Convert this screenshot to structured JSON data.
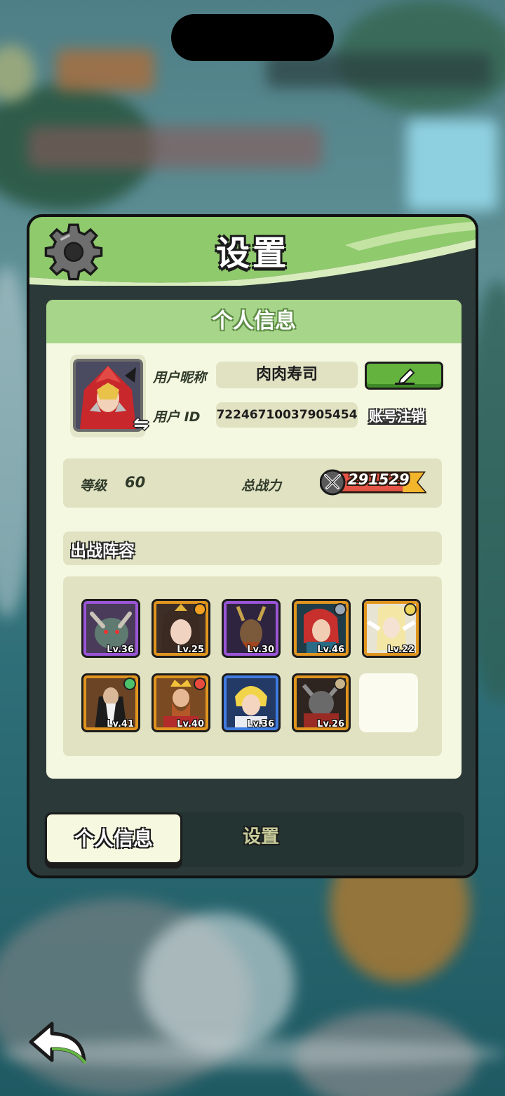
{
  "panel": {
    "title": "设置",
    "section_title": "个人信息"
  },
  "profile": {
    "nickname_label": "用户昵称",
    "nickname": "肉肉寿司",
    "id_label": "用户 ID",
    "user_id": "72246710037905454",
    "logout_label": "账号注销"
  },
  "stats": {
    "level_label": "等级",
    "level": "60",
    "power_label": "总战力",
    "power": "291529"
  },
  "lineup": {
    "title": "出战阵容",
    "heroes": [
      {
        "level": "Lv.36",
        "rarity": "purple"
      },
      {
        "level": "Lv.25",
        "rarity": "orange"
      },
      {
        "level": "Lv.30",
        "rarity": "purple"
      },
      {
        "level": "Lv.46",
        "rarity": "orange"
      },
      {
        "level": "Lv.22",
        "rarity": "orange"
      },
      {
        "level": "Lv.41",
        "rarity": "orange"
      },
      {
        "level": "Lv.40",
        "rarity": "orange"
      },
      {
        "level": "Lv.36",
        "rarity": "blue"
      },
      {
        "level": "Lv.26",
        "rarity": "orange"
      }
    ],
    "empty_slots": 1
  },
  "tabs": {
    "active": "个人信息",
    "inactive": "设置"
  },
  "colors": {
    "panel_green": "#8fca6d",
    "inner_bg": "#f5f8e1",
    "edit_green": "#64b33f",
    "rarity_purple": "#9a55d6",
    "rarity_orange": "#e0951f",
    "rarity_blue": "#3f7be0"
  },
  "icons": [
    "gear-icon",
    "swap-icon",
    "pencil-icon",
    "swords-icon",
    "back-arrow-icon"
  ]
}
